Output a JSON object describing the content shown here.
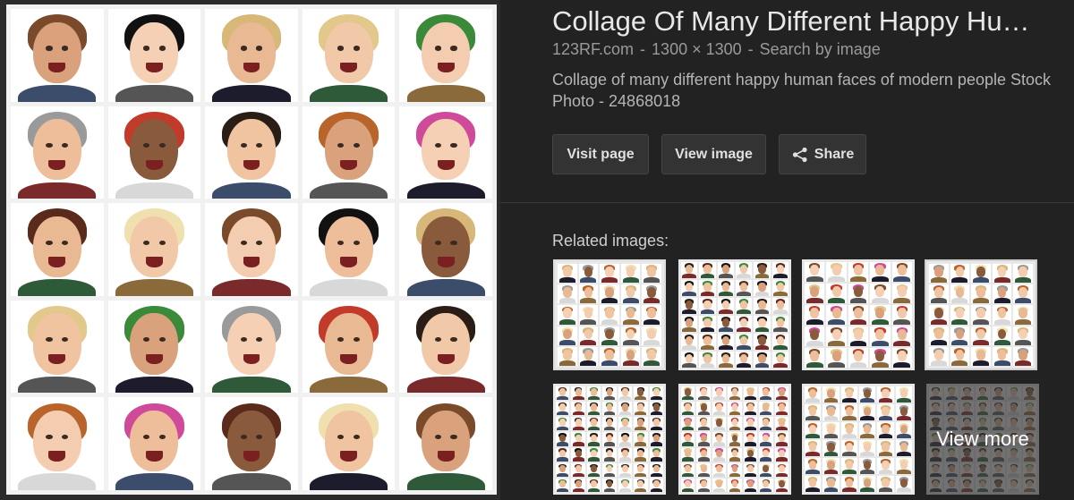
{
  "result": {
    "title": "Collage Of Many Different Happy Hu…",
    "source": "123RF.com",
    "dimensions": "1300 × 1300",
    "search_by_image": "Search by image",
    "separator": "-",
    "description": "Collage of many different happy human faces of modern people Stock Photo - 24868018"
  },
  "buttons": {
    "visit_page": "Visit page",
    "view_image": "View image",
    "share": "Share"
  },
  "icons": {
    "share": "share-icon"
  },
  "related": {
    "label": "Related images:",
    "view_more": "View more"
  },
  "colors": {
    "background": "#222222",
    "title": "#e8e8e8",
    "meta": "#9a9a9a",
    "button_bg": "#333333"
  }
}
